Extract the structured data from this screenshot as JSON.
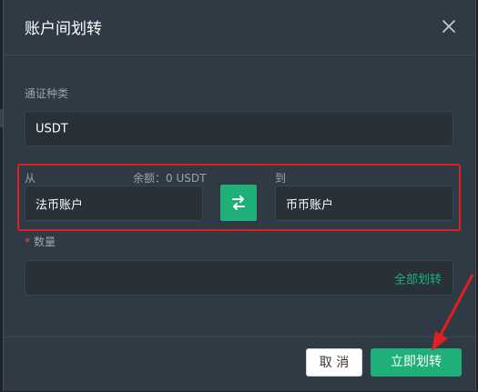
{
  "dialog": {
    "title": "账户间划转",
    "close_icon": "close-icon"
  },
  "currency": {
    "label": "通证种类",
    "value": "USDT"
  },
  "transfer": {
    "from_label": "从",
    "balance_text": "余额：0 USDT",
    "from_account": "法币账户",
    "to_label": "到",
    "to_account": "币币账户",
    "swap_icon": "swap-arrows-icon"
  },
  "amount": {
    "required_mark": "*",
    "label": "数量",
    "value": "",
    "all_link": "全部划转"
  },
  "footer": {
    "cancel_label": "取 消",
    "confirm_label": "立即划转"
  },
  "colors": {
    "accent": "#1fb07a",
    "highlight": "#e02020",
    "background": "#2f3a45"
  }
}
